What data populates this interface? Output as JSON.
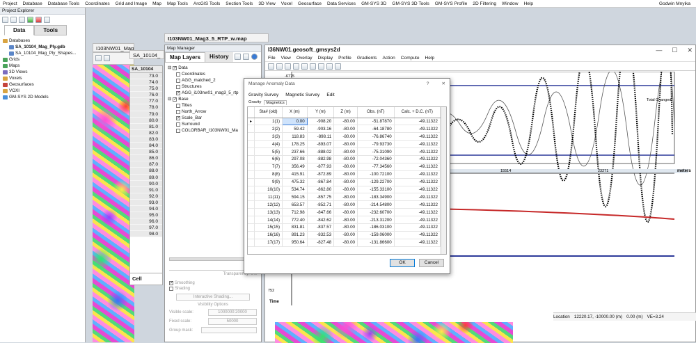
{
  "menubar": {
    "items": [
      "Project",
      "Database",
      "Database Tools",
      "Coordinates",
      "Grid and Image",
      "Map",
      "Map Tools",
      "ArcGIS Tools",
      "Section Tools",
      "3D View",
      "Voxel",
      "Geosurface",
      "Data Services",
      "GM-SYS 3D",
      "GM-SYS 3D Tools",
      "GM-SYS Profile",
      "2D Filtering",
      "Window",
      "Help"
    ],
    "user": "Godwin Mnyika"
  },
  "explorer": {
    "title": "Project Explorer",
    "tabs": [
      "Data",
      "Tools"
    ],
    "tree": [
      {
        "label": "Databases",
        "level": 0
      },
      {
        "label": "SA_10104_Mag_Ply.gdb",
        "level": 1,
        "bold": true
      },
      {
        "label": "SA_10104_Mag_Ply_Shapes...",
        "level": 1
      },
      {
        "label": "Grids",
        "level": 0
      },
      {
        "label": "Maps",
        "level": 0
      },
      {
        "label": "3D Views",
        "level": 0
      },
      {
        "label": "Voxels",
        "level": 0
      },
      {
        "label": "Geosurfaces",
        "level": 0
      },
      {
        "label": "VOXI",
        "level": 0
      },
      {
        "label": "GM-SYS 2D Models",
        "level": 0
      }
    ]
  },
  "gridwin": {
    "title": "I103NW01_Mag3_5_RTP",
    "sub_title": "SA_10104_"
  },
  "valcol": {
    "header": "SA_10104",
    "values": [
      "73.0",
      "74.0",
      "75.0",
      "76.0",
      "77.0",
      "78.0",
      "79.0",
      "80.0",
      "81.0",
      "82.0",
      "83.0",
      "84.0",
      "85.0",
      "86.0",
      "87.0",
      "88.0",
      "89.0",
      "90.0",
      "91.0",
      "92.0",
      "93.0",
      "94.0",
      "95.0",
      "96.0",
      "97.0",
      "98.0"
    ],
    "cell_label": "Cell"
  },
  "mapwin": {
    "title": "I103NW01_Mag3_5_RTP_w.map"
  },
  "mapmgr": {
    "title": "Map Manager",
    "tabs": [
      "Map Layers",
      "History"
    ],
    "data_group": "Data",
    "data_items": [
      {
        "label": "Coordinates",
        "checked": false
      },
      {
        "label": "AGG_matched_2",
        "checked": false
      },
      {
        "label": "Structures",
        "checked": false
      },
      {
        "label": "AGG_i103nw01_mag3_5_rtp",
        "checked": true
      }
    ],
    "base_group": "Base",
    "base_items": [
      {
        "label": "Titles",
        "checked": false
      },
      {
        "label": "North_Arrow",
        "checked": false
      },
      {
        "label": "Scale_Bar",
        "checked": true
      },
      {
        "label": "Surround",
        "checked": false
      },
      {
        "label": "COLORBAR_I103NW01_Ma",
        "checked": false
      }
    ],
    "transparency": "Transparency: 0%",
    "smoothing": "Smoothing",
    "shading": "Shading",
    "interactive_shading": "Interactive Shading...",
    "visibility_options": "Visibility Options",
    "visible_scale_label": "Visible scale:",
    "visible_scale_value": "1000000:20000",
    "fixed_scale_label": "Fixed scale:",
    "fixed_scale_value": "50000",
    "group_mask_label": "Group mask:"
  },
  "gmsys": {
    "title": "I36NW01.geosoft_gmsys2d",
    "menu": [
      "File",
      "View",
      "Overlay",
      "Display",
      "Profile",
      "Gradients",
      "Action",
      "Compute",
      "Help"
    ],
    "legend": "Total Changed",
    "axis_ticks": [
      "15514",
      "23271"
    ],
    "axis_unit": "meters",
    "upper_label": "-6775",
    "lower_label": "752",
    "time_label": "Time",
    "status_location_label": "Location",
    "status_location_value": "12220.17, -10000.00 (m)",
    "status_depth": "0.00 (m)",
    "status_ve": "VE=3.24"
  },
  "dialog": {
    "title": "Manage Anomaly Data",
    "help": "?",
    "tabs": [
      "Gravity Survey",
      "Magnetic Survey",
      "Edit"
    ],
    "subtabs": [
      "Gravity",
      "Magnetics"
    ],
    "columns": [
      "Sta# (old)",
      "X (m)",
      "Y (m)",
      "Z (m)",
      "Obs. (nT)",
      "Calc. + D.C. (nT)"
    ],
    "rows": [
      [
        "1(1)",
        "0.00",
        "-908.20",
        "-80.00",
        "-51.87870",
        "-49.11322"
      ],
      [
        "2(2)",
        "59.42",
        "-903.16",
        "-80.00",
        "-64.18780",
        "-49.11322"
      ],
      [
        "3(3)",
        "118.83",
        "-898.11",
        "-80.00",
        "-76.86740",
        "-49.11322"
      ],
      [
        "4(4)",
        "178.25",
        "-893.07",
        "-80.00",
        "-79.93730",
        "-49.11322"
      ],
      [
        "5(5)",
        "237.66",
        "-888.02",
        "-80.00",
        "-75.31090",
        "-49.11322"
      ],
      [
        "6(6)",
        "297.08",
        "-882.98",
        "-80.00",
        "-72.04360",
        "-49.11322"
      ],
      [
        "7(7)",
        "356.49",
        "-877.93",
        "-80.00",
        "-77.34560",
        "-49.11322"
      ],
      [
        "8(8)",
        "415.91",
        "-872.89",
        "-80.00",
        "-100.72100",
        "-49.11322"
      ],
      [
        "9(9)",
        "475.32",
        "-867.84",
        "-80.00",
        "-129.22700",
        "-49.11322"
      ],
      [
        "10(10)",
        "534.74",
        "-862.80",
        "-80.00",
        "-155.33100",
        "-49.11322"
      ],
      [
        "11(11)",
        "594.15",
        "-857.75",
        "-80.00",
        "-183.34900",
        "-49.11322"
      ],
      [
        "12(12)",
        "653.57",
        "-852.71",
        "-80.00",
        "-214.54800",
        "-49.11322"
      ],
      [
        "13(13)",
        "712.98",
        "-847.66",
        "-80.00",
        "-232.60700",
        "-49.11322"
      ],
      [
        "14(14)",
        "772.40",
        "-842.62",
        "-80.00",
        "-213.31200",
        "-49.11322"
      ],
      [
        "15(15)",
        "831.81",
        "-837.57",
        "-80.00",
        "-186.03100",
        "-49.11322"
      ],
      [
        "16(16)",
        "891.23",
        "-832.53",
        "-80.00",
        "-159.06000",
        "-49.11322"
      ],
      [
        "17(17)",
        "950.64",
        "-827.48",
        "-80.00",
        "-131.86600",
        "-49.11322"
      ]
    ],
    "ok": "OK",
    "cancel": "Cancel"
  }
}
